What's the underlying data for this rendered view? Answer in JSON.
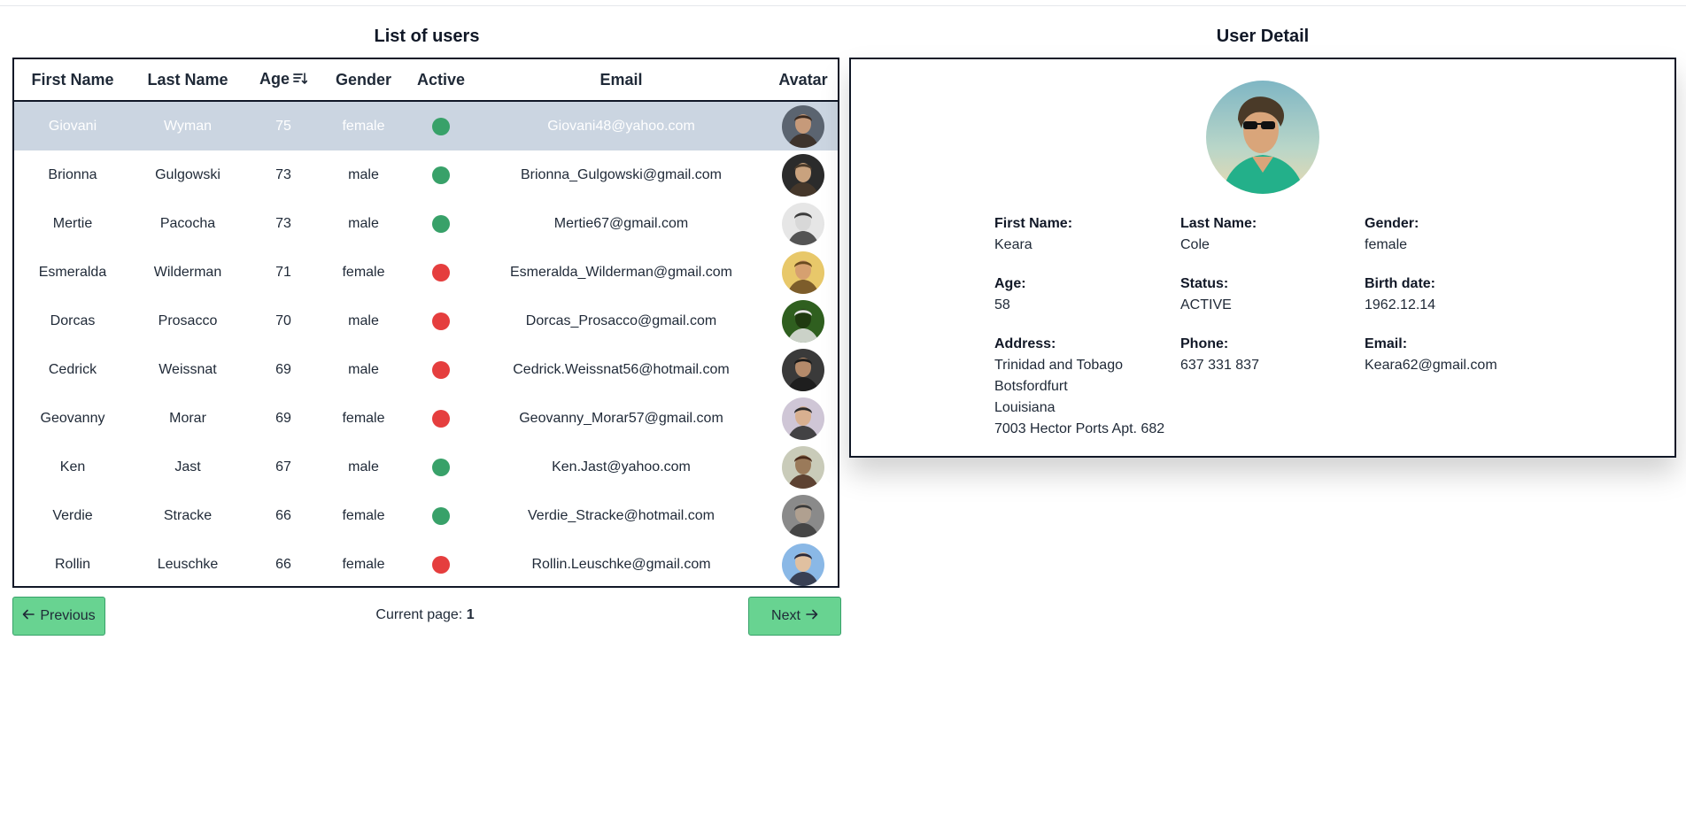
{
  "list": {
    "title": "List of users",
    "columns": {
      "first_name": "First Name",
      "last_name": "Last Name",
      "age": "Age",
      "gender": "Gender",
      "active": "Active",
      "email": "Email",
      "avatar": "Avatar"
    },
    "sort": {
      "column": "Age",
      "direction": "descending"
    },
    "rows": [
      {
        "first": "Giovani",
        "last": "Wyman",
        "age": "75",
        "gender": "female",
        "active": true,
        "email": "Giovani48@yahoo.com",
        "selected": true
      },
      {
        "first": "Brionna",
        "last": "Gulgowski",
        "age": "73",
        "gender": "male",
        "active": true,
        "email": "Brionna_Gulgowski@gmail.com"
      },
      {
        "first": "Mertie",
        "last": "Pacocha",
        "age": "73",
        "gender": "male",
        "active": true,
        "email": "Mertie67@gmail.com"
      },
      {
        "first": "Esmeralda",
        "last": "Wilderman",
        "age": "71",
        "gender": "female",
        "active": false,
        "email": "Esmeralda_Wilderman@gmail.com"
      },
      {
        "first": "Dorcas",
        "last": "Prosacco",
        "age": "70",
        "gender": "male",
        "active": false,
        "email": "Dorcas_Prosacco@gmail.com"
      },
      {
        "first": "Cedrick",
        "last": "Weissnat",
        "age": "69",
        "gender": "male",
        "active": false,
        "email": "Cedrick.Weissnat56@hotmail.com"
      },
      {
        "first": "Geovanny",
        "last": "Morar",
        "age": "69",
        "gender": "female",
        "active": false,
        "email": "Geovanny_Morar57@gmail.com"
      },
      {
        "first": "Ken",
        "last": "Jast",
        "age": "67",
        "gender": "male",
        "active": true,
        "email": "Ken.Jast@yahoo.com"
      },
      {
        "first": "Verdie",
        "last": "Stracke",
        "age": "66",
        "gender": "female",
        "active": true,
        "email": "Verdie_Stracke@hotmail.com"
      },
      {
        "first": "Rollin",
        "last": "Leuschke",
        "age": "66",
        "gender": "female",
        "active": false,
        "email": "Rollin.Leuschke@gmail.com"
      }
    ],
    "colors": {
      "active": "#38a169",
      "inactive": "#e53e3e",
      "selected_row": "#cbd5e1"
    }
  },
  "pagination": {
    "previous_label": "Previous",
    "next_label": "Next",
    "current_page_label": "Current page:",
    "current_page": "1",
    "button_color": "#68d391"
  },
  "detail": {
    "title": "User Detail",
    "first_name_label": "First Name:",
    "first_name": "Keara",
    "last_name_label": "Last Name:",
    "last_name": "Cole",
    "gender_label": "Gender:",
    "gender": "female",
    "age_label": "Age:",
    "age": "58",
    "status_label": "Status:",
    "status": "ACTIVE",
    "birth_label": "Birth date:",
    "birth": "1962.12.14",
    "address_label": "Address:",
    "address": [
      "Trinidad and Tobago",
      "Botsfordfurt",
      "Louisiana",
      "7003 Hector Ports Apt. 682"
    ],
    "phone_label": "Phone:",
    "phone": "637 331 837",
    "email_label": "Email:",
    "email": "Keara62@gmail.com"
  }
}
